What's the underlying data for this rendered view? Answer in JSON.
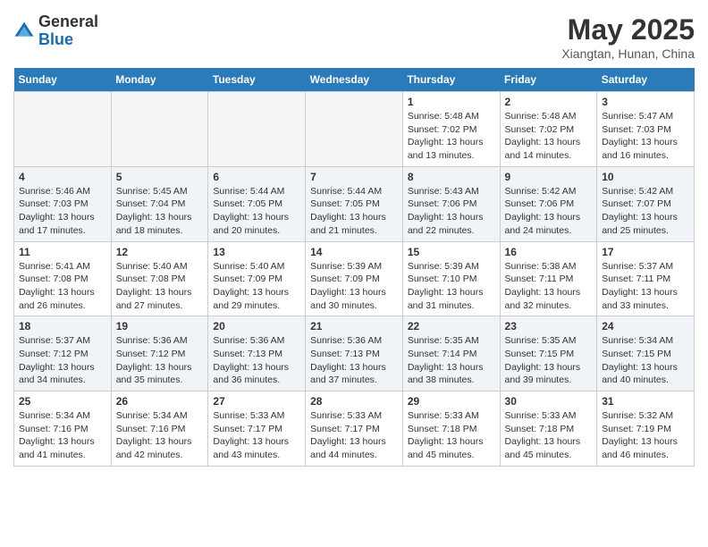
{
  "header": {
    "logo_general": "General",
    "logo_blue": "Blue",
    "month_year": "May 2025",
    "location": "Xiangtan, Hunan, China"
  },
  "calendar": {
    "weekdays": [
      "Sunday",
      "Monday",
      "Tuesday",
      "Wednesday",
      "Thursday",
      "Friday",
      "Saturday"
    ],
    "weeks": [
      [
        {
          "day": "",
          "info": ""
        },
        {
          "day": "",
          "info": ""
        },
        {
          "day": "",
          "info": ""
        },
        {
          "day": "",
          "info": ""
        },
        {
          "day": "1",
          "info": "Sunrise: 5:48 AM\nSunset: 7:02 PM\nDaylight: 13 hours\nand 13 minutes."
        },
        {
          "day": "2",
          "info": "Sunrise: 5:48 AM\nSunset: 7:02 PM\nDaylight: 13 hours\nand 14 minutes."
        },
        {
          "day": "3",
          "info": "Sunrise: 5:47 AM\nSunset: 7:03 PM\nDaylight: 13 hours\nand 16 minutes."
        }
      ],
      [
        {
          "day": "4",
          "info": "Sunrise: 5:46 AM\nSunset: 7:03 PM\nDaylight: 13 hours\nand 17 minutes."
        },
        {
          "day": "5",
          "info": "Sunrise: 5:45 AM\nSunset: 7:04 PM\nDaylight: 13 hours\nand 18 minutes."
        },
        {
          "day": "6",
          "info": "Sunrise: 5:44 AM\nSunset: 7:05 PM\nDaylight: 13 hours\nand 20 minutes."
        },
        {
          "day": "7",
          "info": "Sunrise: 5:44 AM\nSunset: 7:05 PM\nDaylight: 13 hours\nand 21 minutes."
        },
        {
          "day": "8",
          "info": "Sunrise: 5:43 AM\nSunset: 7:06 PM\nDaylight: 13 hours\nand 22 minutes."
        },
        {
          "day": "9",
          "info": "Sunrise: 5:42 AM\nSunset: 7:06 PM\nDaylight: 13 hours\nand 24 minutes."
        },
        {
          "day": "10",
          "info": "Sunrise: 5:42 AM\nSunset: 7:07 PM\nDaylight: 13 hours\nand 25 minutes."
        }
      ],
      [
        {
          "day": "11",
          "info": "Sunrise: 5:41 AM\nSunset: 7:08 PM\nDaylight: 13 hours\nand 26 minutes."
        },
        {
          "day": "12",
          "info": "Sunrise: 5:40 AM\nSunset: 7:08 PM\nDaylight: 13 hours\nand 27 minutes."
        },
        {
          "day": "13",
          "info": "Sunrise: 5:40 AM\nSunset: 7:09 PM\nDaylight: 13 hours\nand 29 minutes."
        },
        {
          "day": "14",
          "info": "Sunrise: 5:39 AM\nSunset: 7:09 PM\nDaylight: 13 hours\nand 30 minutes."
        },
        {
          "day": "15",
          "info": "Sunrise: 5:39 AM\nSunset: 7:10 PM\nDaylight: 13 hours\nand 31 minutes."
        },
        {
          "day": "16",
          "info": "Sunrise: 5:38 AM\nSunset: 7:11 PM\nDaylight: 13 hours\nand 32 minutes."
        },
        {
          "day": "17",
          "info": "Sunrise: 5:37 AM\nSunset: 7:11 PM\nDaylight: 13 hours\nand 33 minutes."
        }
      ],
      [
        {
          "day": "18",
          "info": "Sunrise: 5:37 AM\nSunset: 7:12 PM\nDaylight: 13 hours\nand 34 minutes."
        },
        {
          "day": "19",
          "info": "Sunrise: 5:36 AM\nSunset: 7:12 PM\nDaylight: 13 hours\nand 35 minutes."
        },
        {
          "day": "20",
          "info": "Sunrise: 5:36 AM\nSunset: 7:13 PM\nDaylight: 13 hours\nand 36 minutes."
        },
        {
          "day": "21",
          "info": "Sunrise: 5:36 AM\nSunset: 7:13 PM\nDaylight: 13 hours\nand 37 minutes."
        },
        {
          "day": "22",
          "info": "Sunrise: 5:35 AM\nSunset: 7:14 PM\nDaylight: 13 hours\nand 38 minutes."
        },
        {
          "day": "23",
          "info": "Sunrise: 5:35 AM\nSunset: 7:15 PM\nDaylight: 13 hours\nand 39 minutes."
        },
        {
          "day": "24",
          "info": "Sunrise: 5:34 AM\nSunset: 7:15 PM\nDaylight: 13 hours\nand 40 minutes."
        }
      ],
      [
        {
          "day": "25",
          "info": "Sunrise: 5:34 AM\nSunset: 7:16 PM\nDaylight: 13 hours\nand 41 minutes."
        },
        {
          "day": "26",
          "info": "Sunrise: 5:34 AM\nSunset: 7:16 PM\nDaylight: 13 hours\nand 42 minutes."
        },
        {
          "day": "27",
          "info": "Sunrise: 5:33 AM\nSunset: 7:17 PM\nDaylight: 13 hours\nand 43 minutes."
        },
        {
          "day": "28",
          "info": "Sunrise: 5:33 AM\nSunset: 7:17 PM\nDaylight: 13 hours\nand 44 minutes."
        },
        {
          "day": "29",
          "info": "Sunrise: 5:33 AM\nSunset: 7:18 PM\nDaylight: 13 hours\nand 45 minutes."
        },
        {
          "day": "30",
          "info": "Sunrise: 5:33 AM\nSunset: 7:18 PM\nDaylight: 13 hours\nand 45 minutes."
        },
        {
          "day": "31",
          "info": "Sunrise: 5:32 AM\nSunset: 7:19 PM\nDaylight: 13 hours\nand 46 minutes."
        }
      ]
    ]
  }
}
